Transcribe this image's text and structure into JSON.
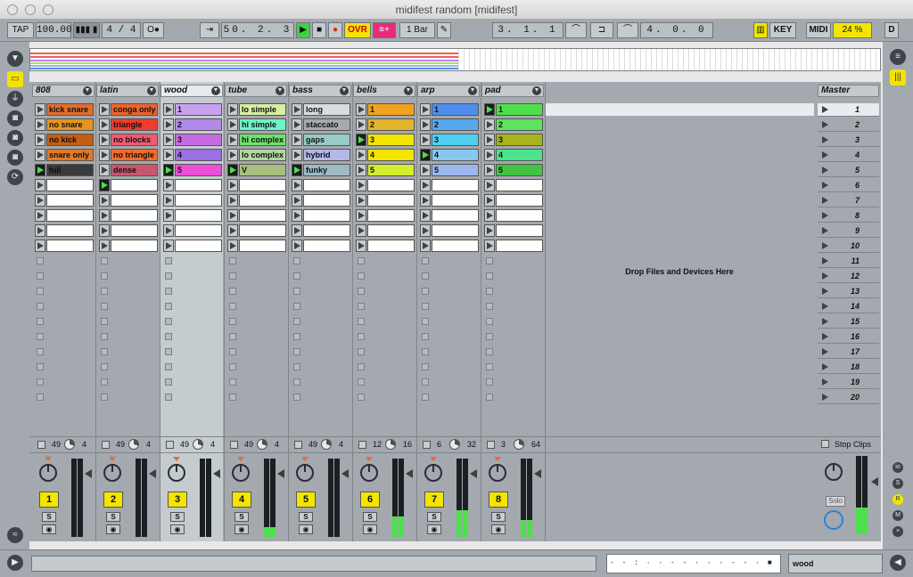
{
  "window": {
    "title": "midifest random  [midifest]"
  },
  "control_bar": {
    "tap": "TAP",
    "tempo": "100.00",
    "signature": "4 / 4",
    "follow_icon": "follow-arrow-icon",
    "position": "50.  2.  3",
    "ovr": "OVR",
    "quantize": "1 Bar",
    "loop_start": "3.  1.  1",
    "loop_length": "4.  0.  0",
    "key": "KEY",
    "midi": "MIDI",
    "cpu": "24 %",
    "disk": "D"
  },
  "tracks": [
    {
      "name": "808",
      "color": "#e56d2c",
      "clips": [
        {
          "name": "kick snare",
          "color": "#e56d2c"
        },
        {
          "name": "no snare",
          "color": "#e2951f"
        },
        {
          "name": "no kick",
          "color": "#c45e15"
        },
        {
          "name": "snare only",
          "color": "#e07a2a"
        },
        {
          "name": "full",
          "color": "#3a3a3a"
        }
      ],
      "playing_slot": 5,
      "send1": "49",
      "send2": "4",
      "number": "1",
      "level": 0
    },
    {
      "name": "latin",
      "color": "#e56d2c",
      "clips": [
        {
          "name": "conga only",
          "color": "#f0622c"
        },
        {
          "name": "triangle",
          "color": "#f23a2d"
        },
        {
          "name": "no blocks",
          "color": "#f25a70"
        },
        {
          "name": "no triangle",
          "color": "#f26c2c"
        },
        {
          "name": "dense",
          "color": "#c9566d"
        }
      ],
      "playing_slot": 6,
      "send1": "49",
      "send2": "4",
      "number": "2",
      "level": 0
    },
    {
      "name": "wood",
      "color": "#c07ee6",
      "clips": [
        {
          "name": "1",
          "color": "#c9a2ef"
        },
        {
          "name": "2",
          "color": "#b08aea"
        },
        {
          "name": "3",
          "color": "#c76ae0"
        },
        {
          "name": "4",
          "color": "#9a70e2"
        },
        {
          "name": "5",
          "color": "#ee4fd8"
        }
      ],
      "playing_slot": 5,
      "send1": "49",
      "send2": "4",
      "number": "3",
      "level": 0
    },
    {
      "name": "tube",
      "color": "#a7e06c",
      "clips": [
        {
          "name": "lo simple",
          "color": "#d6f0a0"
        },
        {
          "name": "hi simple",
          "color": "#6ef2c8"
        },
        {
          "name": "hi complex",
          "color": "#6ee36c"
        },
        {
          "name": "lo complex",
          "color": "#b2d7a0"
        },
        {
          "name": "V",
          "color": "#a7c07e"
        }
      ],
      "playing_slot": 5,
      "send1": "49",
      "send2": "4",
      "number": "4",
      "level": 0.12
    },
    {
      "name": "bass",
      "color": "#9dc0cc",
      "clips": [
        {
          "name": "long",
          "color": "#d6dcdf"
        },
        {
          "name": "staccato",
          "color": "#a7aaab"
        },
        {
          "name": "gaps",
          "color": "#97cbc5"
        },
        {
          "name": "hybrid",
          "color": "#b4b8e8"
        },
        {
          "name": "funky",
          "color": "#9dbac6"
        }
      ],
      "playing_slot": 5,
      "send1": "49",
      "send2": "4",
      "number": "5",
      "level": 0
    },
    {
      "name": "bells",
      "color": "#f3c200",
      "clips": [
        {
          "name": "1",
          "color": "#f3a21c"
        },
        {
          "name": "2",
          "color": "#e2b52a"
        },
        {
          "name": "3",
          "color": "#f3e500"
        },
        {
          "name": "4",
          "color": "#f3e500"
        },
        {
          "name": "5",
          "color": "#d5ed2e"
        }
      ],
      "playing_slot": 3,
      "send1": "12",
      "send2": "16",
      "number": "6",
      "level": 0.26
    },
    {
      "name": "arp",
      "color": "#4fa8f3",
      "clips": [
        {
          "name": "1",
          "color": "#4e8df0"
        },
        {
          "name": "2",
          "color": "#58a8f0"
        },
        {
          "name": "3",
          "color": "#4fd0f3"
        },
        {
          "name": "4",
          "color": "#88c8f0"
        },
        {
          "name": "5",
          "color": "#9ab7f0"
        }
      ],
      "playing_slot": 4,
      "send1": "6",
      "send2": "32",
      "number": "7",
      "level": 0.34
    },
    {
      "name": "pad",
      "color": "#4ce04b",
      "clips": [
        {
          "name": "1",
          "color": "#4ce04b"
        },
        {
          "name": "2",
          "color": "#5de55d"
        },
        {
          "name": "3",
          "color": "#a9b31a"
        },
        {
          "name": "4",
          "color": "#4ce48c"
        },
        {
          "name": "5",
          "color": "#41c441"
        }
      ],
      "playing_slot": 1,
      "send1": "3",
      "send2": "64",
      "number": "8",
      "level": 0.22
    }
  ],
  "drop_zone": "Drop Files and Devices Here",
  "master": {
    "name": "Master",
    "scenes": [
      "1",
      "2",
      "3",
      "4",
      "5",
      "6",
      "7",
      "8",
      "9",
      "10",
      "11",
      "12",
      "13",
      "14",
      "15",
      "16",
      "17",
      "18",
      "19",
      "20"
    ],
    "stop_clips": "Stop Clips",
    "solo": "Solo"
  },
  "mixer_labels": {
    "solo": "S",
    "arm_icon": "record-arm-icon"
  },
  "status_bar": {
    "mini_overview": "- - : · · - - · · ·  -  - · ■ ·",
    "selected_track": "wood"
  }
}
